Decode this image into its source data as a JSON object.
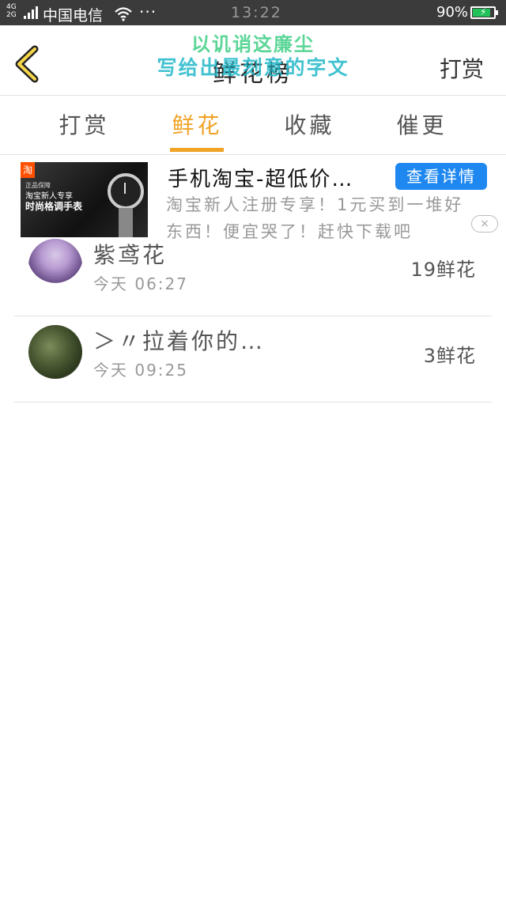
{
  "status_bar": {
    "network_top": "4G",
    "network_bottom": "2G",
    "carrier": "中国电信",
    "more": "···",
    "time": "13:22",
    "battery_pct": "90%",
    "battery_level": 0.9,
    "battery_color": "#22c25a"
  },
  "header": {
    "title": "鲜花榜",
    "action_label": "打赏",
    "watermark_line1": "以讥诮这廉尘",
    "watermark_line2": "写给出最刻意的字文"
  },
  "tabs": [
    {
      "label": "打赏",
      "active": false
    },
    {
      "label": "鲜花",
      "active": true
    },
    {
      "label": "收藏",
      "active": false
    },
    {
      "label": "催更",
      "active": false
    }
  ],
  "accent_color": "#f0a325",
  "ad": {
    "title": "手机淘宝-超低价…",
    "button_label": "查看详情",
    "description": "淘宝新人注册专享！1元买到一堆好东西！便宜哭了！赶快下载吧",
    "image_brand": "正品保障",
    "image_line1": "淘宝新人专享",
    "image_line2": "时尚格调手表",
    "close_icon": "×"
  },
  "list": [
    {
      "name": "紫鸢花",
      "time": "今天 06:27",
      "count": "19鲜花"
    },
    {
      "name": "＞〃拉着你的…",
      "time": "今天 09:25",
      "count": "3鲜花"
    }
  ]
}
